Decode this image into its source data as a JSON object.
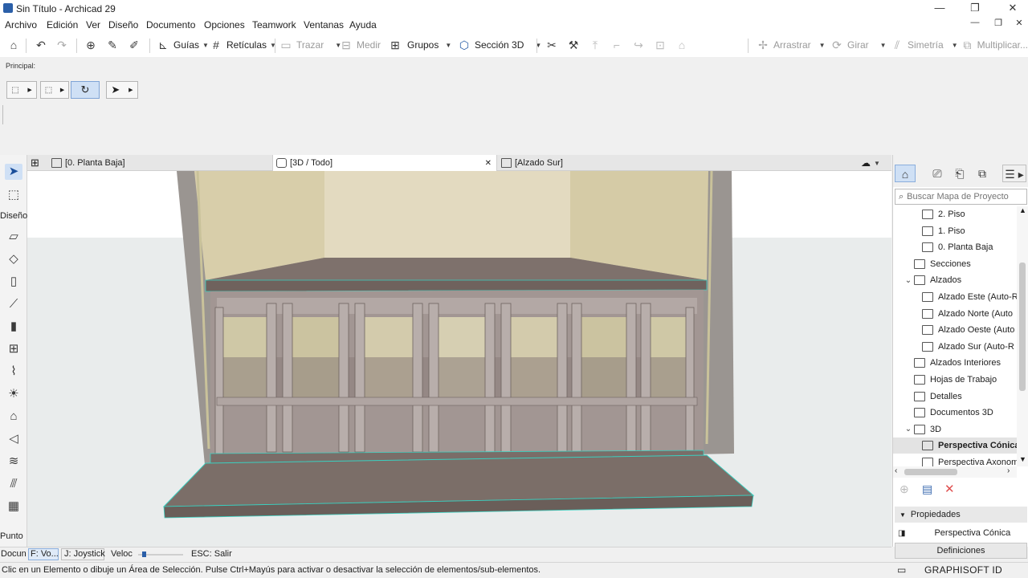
{
  "window": {
    "title": "Sin Título - Archicad 29",
    "controls": {
      "minimize": "—",
      "restore": "❐",
      "close": "✕",
      "inner_min": "—",
      "inner_restore": "❐",
      "inner_close": "✕"
    }
  },
  "menu": [
    "Archivo",
    "Edición",
    "Ver",
    "Diseño",
    "Documento",
    "Opciones",
    "Teamwork",
    "Ventanas",
    "Ayuda"
  ],
  "toolbar": {
    "guias": "Guías",
    "reticulas": "Retículas",
    "trazar": "Trazar",
    "medir": "Medir",
    "grupos": "Grupos",
    "seccion3d": "Sección 3D",
    "arrastrar": "Arrastrar",
    "girar": "Girar",
    "simetria": "Simetría",
    "multiplicar": "Multiplicar..."
  },
  "infobox": {
    "label": "Principal:"
  },
  "tabs": [
    {
      "label": "[0. Planta Baja]"
    },
    {
      "label": "[3D / Todo]",
      "close": "✕"
    },
    {
      "label": "[Alzado Sur]"
    }
  ],
  "toolbox": {
    "group_design": "Diseño",
    "group_point": "Punto",
    "group_doc": "Docun"
  },
  "navigator": {
    "search_placeholder": "Buscar Mapa de Proyecto",
    "tree": [
      {
        "label": "2. Piso",
        "indent": 2,
        "arrow": ""
      },
      {
        "label": "1. Piso",
        "indent": 2,
        "arrow": ""
      },
      {
        "label": "0. Planta Baja",
        "indent": 2,
        "arrow": ""
      },
      {
        "label": "Secciones",
        "indent": 1,
        "arrow": ""
      },
      {
        "label": "Alzados",
        "indent": 1,
        "arrow": "⌄"
      },
      {
        "label": "Alzado Este (Auto-R",
        "indent": 2,
        "arrow": ""
      },
      {
        "label": "Alzado Norte (Auto",
        "indent": 2,
        "arrow": ""
      },
      {
        "label": "Alzado Oeste (Auto",
        "indent": 2,
        "arrow": ""
      },
      {
        "label": "Alzado Sur (Auto-R",
        "indent": 2,
        "arrow": ""
      },
      {
        "label": "Alzados Interiores",
        "indent": 1,
        "arrow": ""
      },
      {
        "label": "Hojas de Trabajo",
        "indent": 1,
        "arrow": ""
      },
      {
        "label": "Detalles",
        "indent": 1,
        "arrow": ""
      },
      {
        "label": "Documentos 3D",
        "indent": 1,
        "arrow": ""
      },
      {
        "label": "3D",
        "indent": 1,
        "arrow": "⌄"
      },
      {
        "label": "Perspectiva Cónica",
        "indent": 2,
        "arrow": "",
        "selected": true
      },
      {
        "label": "Perspectiva Axonom",
        "indent": 2,
        "arrow": ""
      }
    ],
    "properties_label": "Propiedades",
    "properties_value": "Perspectiva Cónica",
    "definitions_label": "Definiciones"
  },
  "bottombar": {
    "doc": "Docun",
    "mode_fly": "F: Vo...",
    "mode_joystick": "J: Joystick",
    "speed_label": "Veloc",
    "speed_level": 0.1,
    "esc": "ESC: Salir"
  },
  "status": {
    "message": "Clic en un Elemento o dibuje un Área de Selección. Pulse Ctrl+Mayús para activar o desactivar la selección de elementos/sub-elementos.",
    "brand": "GRAPHISOFT ID"
  },
  "colors": {
    "accent": "#2b5fa8",
    "selection": "#cfe0f5",
    "wall_beige": "#d8ceaa",
    "wood": "#7b6e68",
    "frame": "#9a8f8a",
    "edge_highlight": "#3bd0c0"
  }
}
